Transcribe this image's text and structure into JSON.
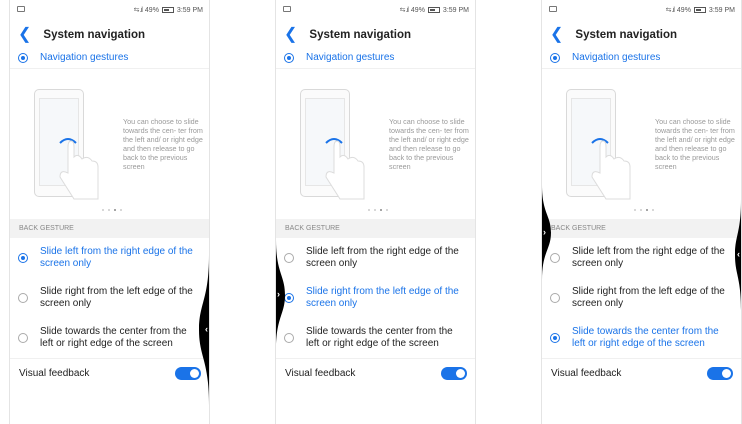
{
  "status": {
    "signal": "⇆ .ıl",
    "battery_pct": "49%",
    "time": "3:59 PM"
  },
  "header": {
    "title": "System navigation"
  },
  "nav_option": {
    "label": "Navigation gestures"
  },
  "illustration": {
    "description": "You can choose to slide towards the cen- ter from the left and/ or right edge and then release to go back to the previous screen"
  },
  "back_gesture": {
    "section_title": "BACK GESTURE",
    "options": [
      {
        "label": "Slide left from the right edge of the screen only"
      },
      {
        "label": "Slide right from the left edge of the screen only"
      },
      {
        "label": "Slide towards the center from the left or right edge of the screen"
      }
    ]
  },
  "visual_feedback": {
    "label": "Visual feedback",
    "enabled": true
  },
  "screens": [
    {
      "selected_back_option": 0,
      "edge": "right"
    },
    {
      "selected_back_option": 1,
      "edge": "left"
    },
    {
      "selected_back_option": 2,
      "edge": "both"
    }
  ],
  "colors": {
    "accent": "#1a73e8",
    "edge_indicator": "#000000"
  },
  "icons": [
    "back-arrow-icon",
    "image-icon",
    "signal-icon",
    "battery-icon",
    "phone-icon",
    "hand-swipe-icon",
    "chevron-left-icon",
    "chevron-right-icon",
    "radio-icon",
    "toggle-switch"
  ]
}
